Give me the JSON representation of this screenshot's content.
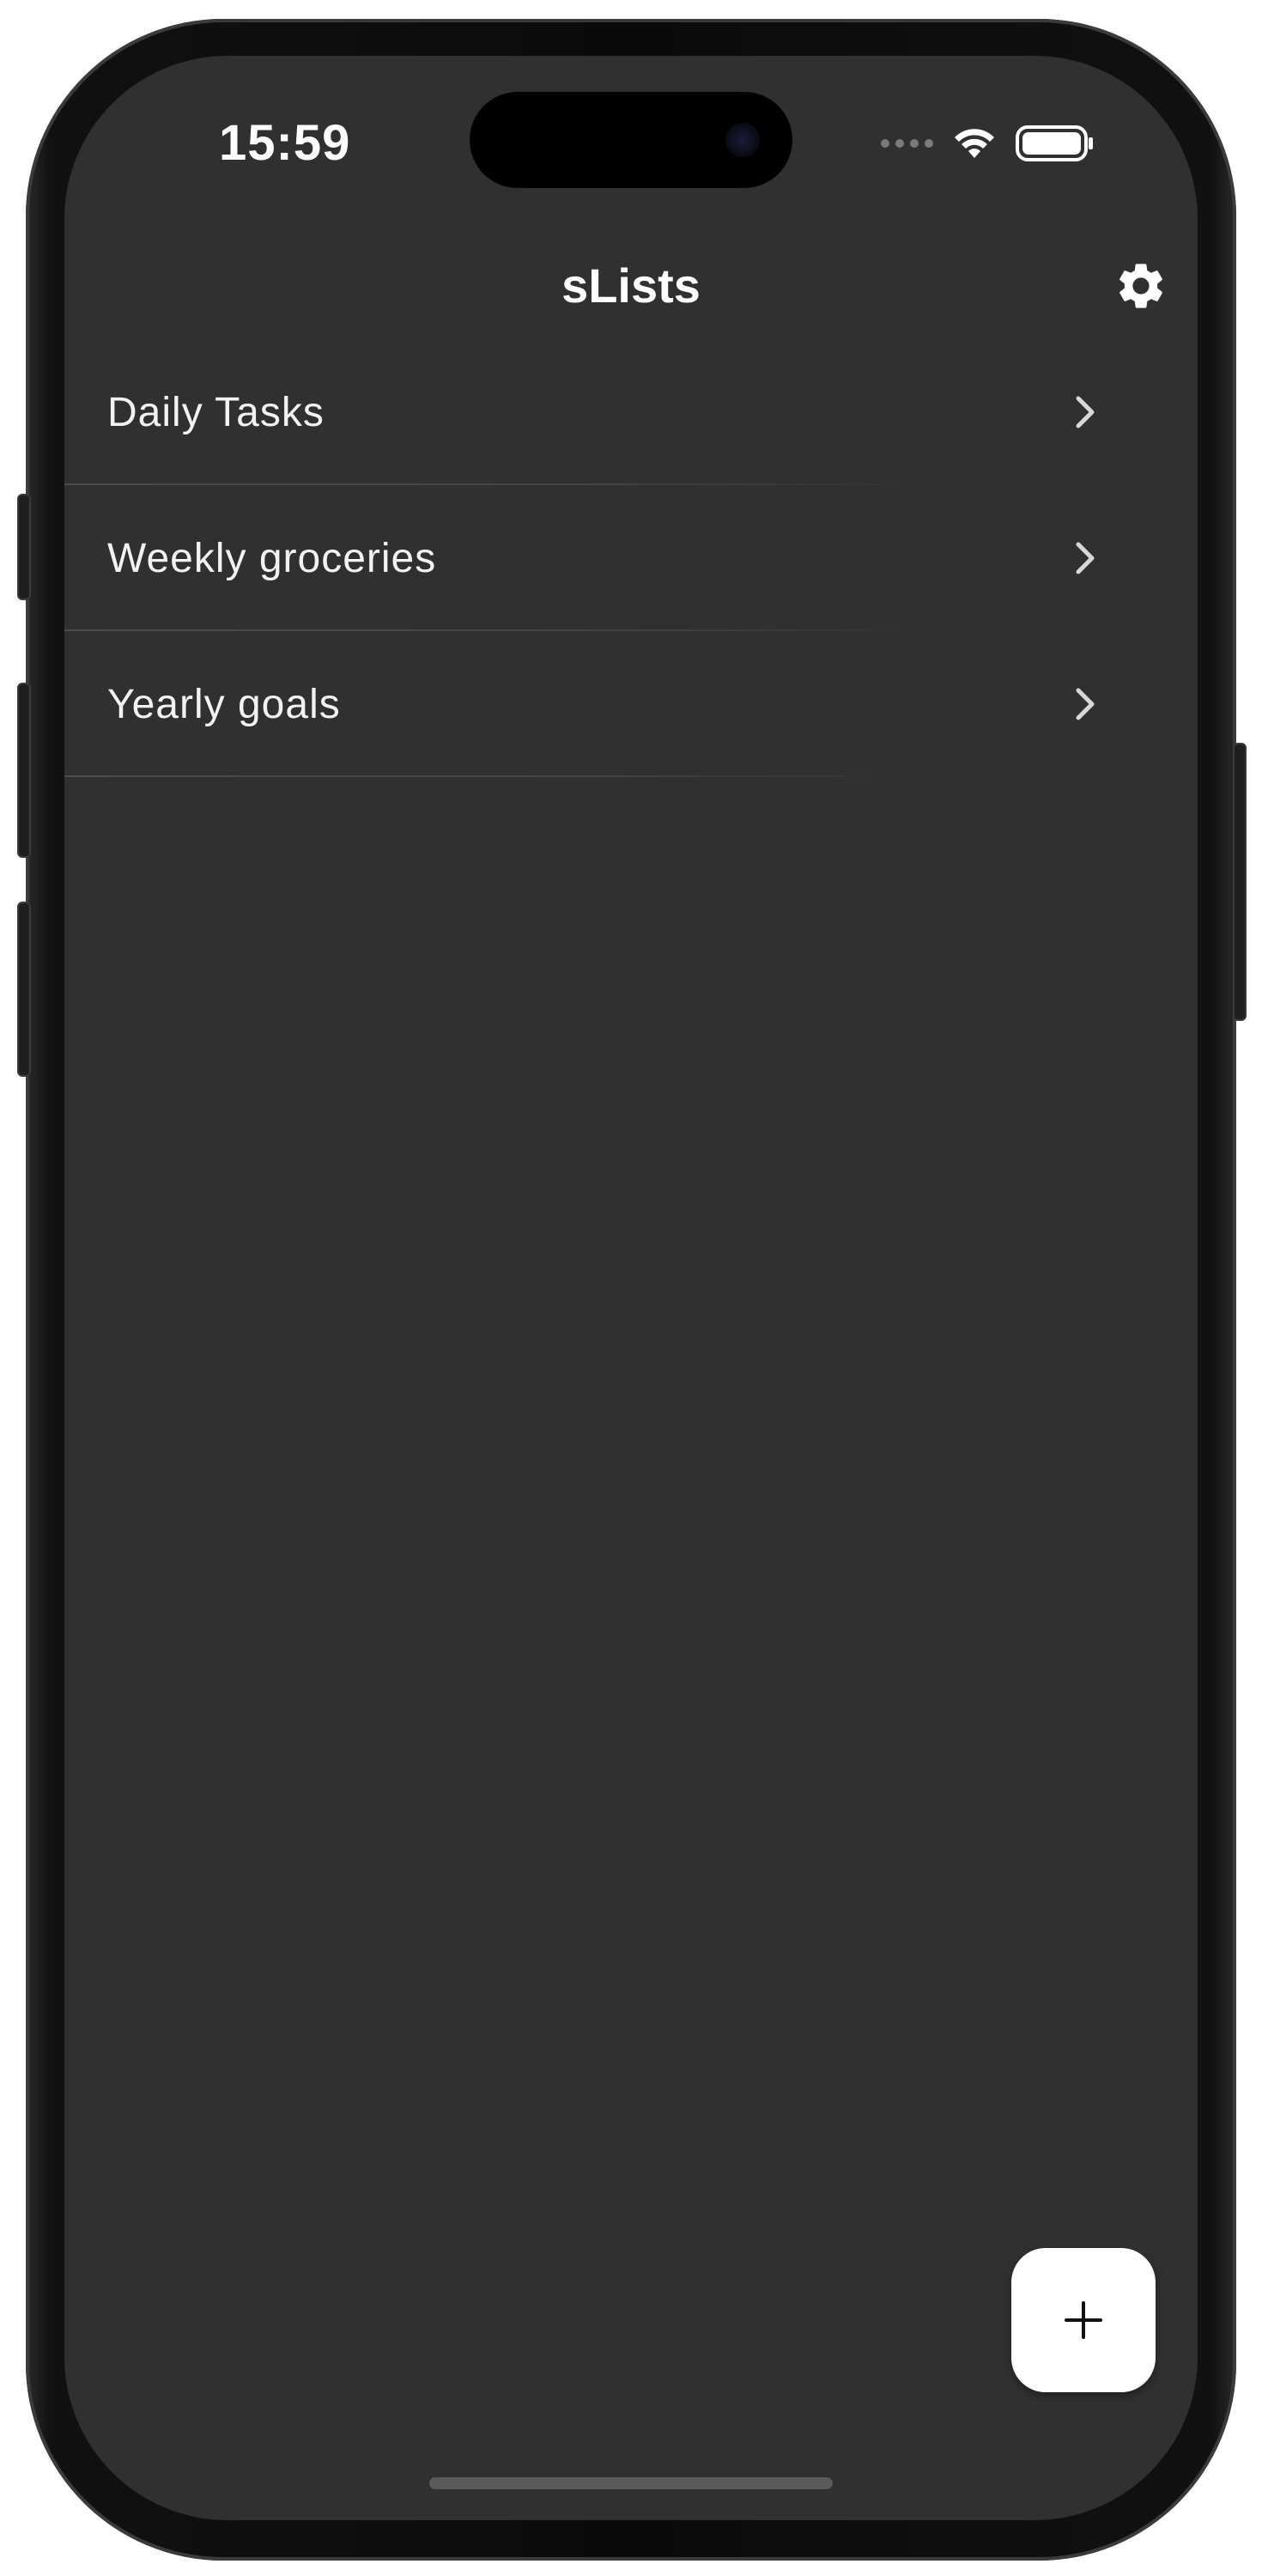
{
  "status_bar": {
    "time": "15:59",
    "icons": [
      "signal-icon",
      "wifi-icon",
      "battery-icon"
    ]
  },
  "nav": {
    "title": "sLists",
    "settings_icon": "gear-icon"
  },
  "lists": [
    {
      "label": "Daily Tasks"
    },
    {
      "label": "Weekly groceries"
    },
    {
      "label": "Yearly goals"
    }
  ],
  "fab": {
    "icon": "plus-icon"
  },
  "colors": {
    "background": "#303030",
    "text": "#ffffff",
    "fab": "#ffffff"
  }
}
